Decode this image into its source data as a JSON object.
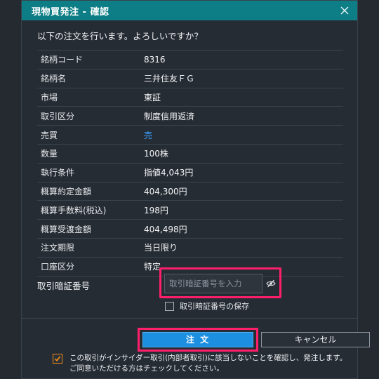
{
  "dialog": {
    "title": "現物買発注 - 確認",
    "prompt": "以下の注文を行います。よろしいですか？"
  },
  "rows": [
    {
      "label": "銘柄コード",
      "value": "8316"
    },
    {
      "label": "銘柄名",
      "value": "三井住友ＦＧ"
    },
    {
      "label": "市場",
      "value": "東証"
    },
    {
      "label": "取引区分",
      "value": "制度信用返済"
    },
    {
      "label": "売買",
      "value": "売"
    },
    {
      "label": "数量",
      "value": "100株"
    },
    {
      "label": "執行条件",
      "value": "指値4,043円"
    },
    {
      "label": "概算約定金額",
      "value": "404,300円"
    },
    {
      "label": "概算手数料(税込)",
      "value": "198円"
    },
    {
      "label": "概算受渡金額",
      "value": "404,498円"
    },
    {
      "label": "注文期限",
      "value": "当日限り"
    },
    {
      "label": "口座区分",
      "value": "特定"
    }
  ],
  "pin": {
    "label": "取引暗証番号",
    "placeholder": "取引暗証番号を入力",
    "value": "",
    "save_label": "取引暗証番号の保存",
    "save_checked": false
  },
  "actions": {
    "order_label": "注 文",
    "cancel_label": "キャンセル"
  },
  "confirm": {
    "checked": true,
    "line1": "この取引がインサイダー取引(内部者取引)に該当しないことを確認し、発注します。",
    "line2": "ご同意いただける方はチェックしてください。"
  },
  "colors": {
    "titlebar": "#0e7e86",
    "sell": "#3aa0ff",
    "order_button": "#1d8fe0",
    "highlight": "#ff1f6b",
    "checkbox_accent": "#f08a14"
  },
  "icons": {
    "close": "close-icon",
    "eye": "eye-slash-icon",
    "check": "checkmark-icon"
  }
}
